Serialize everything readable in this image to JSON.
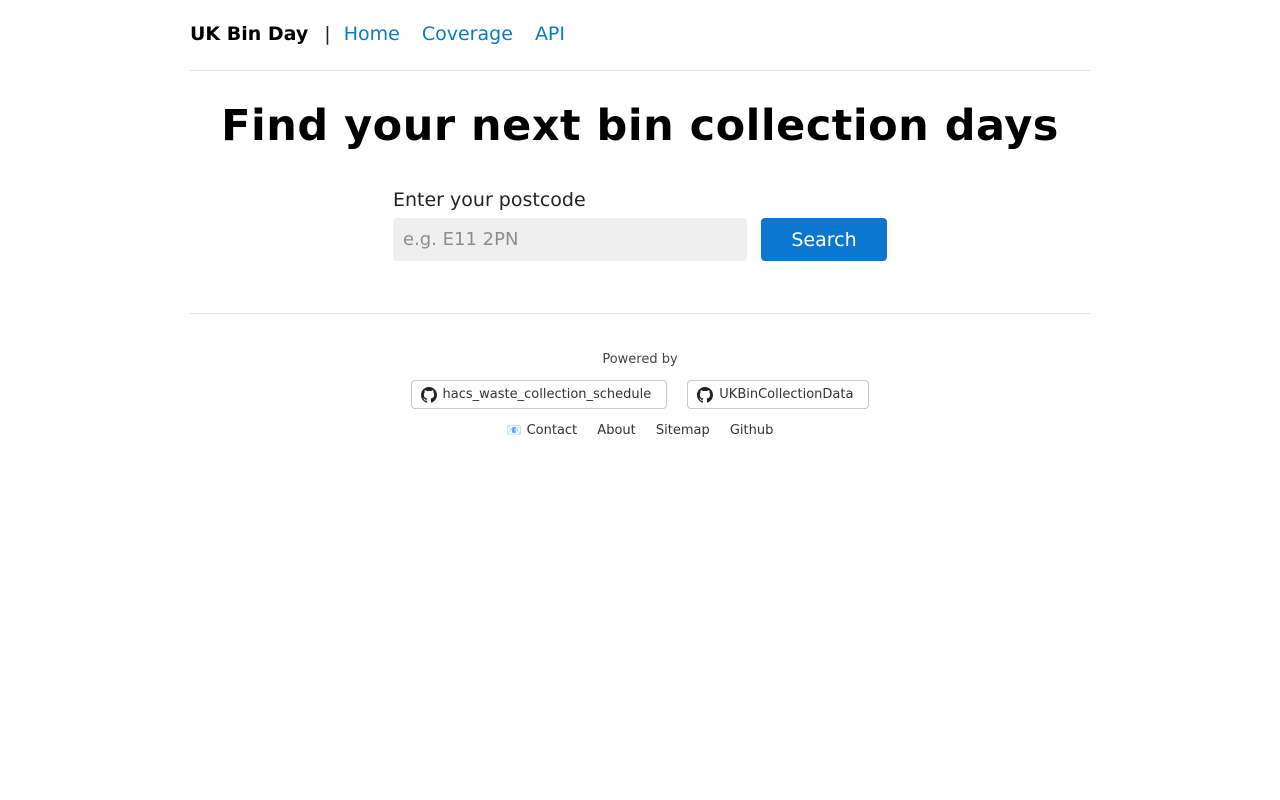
{
  "header": {
    "brand": "UK Bin Day",
    "separator": "|",
    "nav": [
      "Home",
      "Coverage",
      "API"
    ]
  },
  "main": {
    "title": "Find your next bin collection days",
    "postcode_label": "Enter your postcode",
    "postcode_placeholder": "e.g. E11 2PN",
    "search_button": "Search"
  },
  "footer": {
    "powered_by": "Powered by",
    "badges": [
      {
        "icon": "github-icon",
        "label": "hacs_waste_collection_schedule"
      },
      {
        "icon": "github-icon",
        "label": "UKBinCollectionData"
      }
    ],
    "contact_icon": "📧",
    "links": [
      "Contact",
      "About",
      "Sitemap",
      "Github"
    ]
  },
  "colors": {
    "link": "#0a7bc1",
    "button": "#0b77d1",
    "input_bg": "#efefef"
  }
}
